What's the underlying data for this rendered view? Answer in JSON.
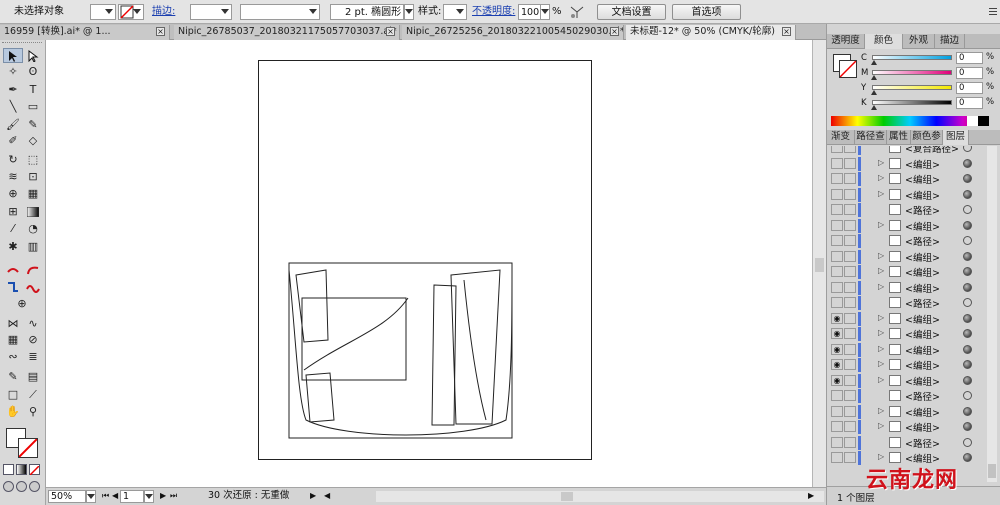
{
  "control_bar": {
    "selection_status": "未选择对象",
    "stroke_label": "描边:",
    "brush_label": "2 pt. 椭圆形",
    "style_label": "样式:",
    "opacity_label": "不透明度:",
    "opacity_value": "100",
    "opacity_unit": "%",
    "doc_setup_button": "文档设置",
    "preferences_button": "首选项"
  },
  "tabs": [
    {
      "label": "16959 [转换].ai* @ 1..."
    },
    {
      "label": "Nipic_26785037_20180321175057703037.ai*"
    },
    {
      "label": "Nipic_26725256_20180322100545029030.ai*"
    },
    {
      "label": "未标题-12* @ 50% (CMYK/轮廓)"
    }
  ],
  "color_panel": {
    "tabs": [
      "透明度",
      "颜色",
      "外观",
      "描边"
    ],
    "active_tab": "颜色",
    "channels": [
      {
        "name": "C",
        "value": "0",
        "color": "#00a0e0"
      },
      {
        "name": "M",
        "value": "0",
        "color": "#e0007a"
      },
      {
        "name": "Y",
        "value": "0",
        "color": "#f3e800"
      },
      {
        "name": "K",
        "value": "0",
        "color": "#000000"
      }
    ],
    "unit": "%"
  },
  "layers_panel": {
    "tabs": [
      "渐变",
      "路径查",
      "属性",
      "颜色参",
      "图层"
    ],
    "active_tab": "图层",
    "rows": [
      {
        "name": "<复合路径>",
        "visible": false,
        "expandable": false,
        "target_filled": false
      },
      {
        "name": "<编组>",
        "visible": false,
        "expandable": true,
        "target_filled": true
      },
      {
        "name": "<编组>",
        "visible": false,
        "expandable": true,
        "target_filled": true
      },
      {
        "name": "<编组>",
        "visible": false,
        "expandable": true,
        "target_filled": true
      },
      {
        "name": "<路径>",
        "visible": false,
        "expandable": false,
        "target_filled": false
      },
      {
        "name": "<编组>",
        "visible": false,
        "expandable": true,
        "target_filled": true
      },
      {
        "name": "<路径>",
        "visible": false,
        "expandable": false,
        "target_filled": false
      },
      {
        "name": "<编组>",
        "visible": false,
        "expandable": true,
        "target_filled": true
      },
      {
        "name": "<编组>",
        "visible": false,
        "expandable": true,
        "target_filled": true
      },
      {
        "name": "<编组>",
        "visible": false,
        "expandable": true,
        "target_filled": true
      },
      {
        "name": "<路径>",
        "visible": false,
        "expandable": false,
        "target_filled": false
      },
      {
        "name": "<编组>",
        "visible": true,
        "expandable": true,
        "target_filled": true
      },
      {
        "name": "<编组>",
        "visible": true,
        "expandable": true,
        "target_filled": true
      },
      {
        "name": "<编组>",
        "visible": true,
        "expandable": true,
        "target_filled": true
      },
      {
        "name": "<编组>",
        "visible": true,
        "expandable": true,
        "target_filled": true
      },
      {
        "name": "<编组>",
        "visible": true,
        "expandable": true,
        "target_filled": true
      },
      {
        "name": "<路径>",
        "visible": false,
        "expandable": false,
        "target_filled": false
      },
      {
        "name": "<编组>",
        "visible": false,
        "expandable": true,
        "target_filled": true
      },
      {
        "name": "<编组>",
        "visible": false,
        "expandable": true,
        "target_filled": true
      },
      {
        "name": "<路径>",
        "visible": false,
        "expandable": false,
        "target_filled": false
      },
      {
        "name": "<编组>",
        "visible": false,
        "expandable": true,
        "target_filled": true
      }
    ],
    "footer": "1 个图层"
  },
  "status_bar": {
    "zoom": "50%",
    "artboard": "1",
    "info": "30 次还原 : 无重做"
  },
  "watermark": "云南龙网"
}
